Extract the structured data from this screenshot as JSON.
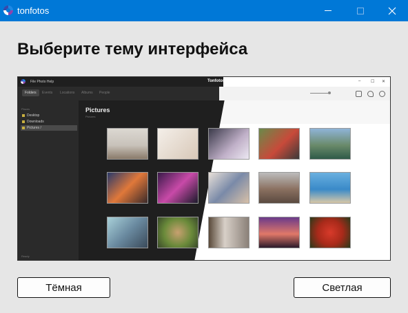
{
  "window": {
    "title": "tonfotos",
    "controls": {
      "minimize": "minimize-icon",
      "maximize": "maximize-icon",
      "close": "close-icon"
    }
  },
  "heading": "Выберите тему интерфейса",
  "preview": {
    "menu": "File  Photo  Help",
    "app_name": "Tonfotos",
    "tabs": [
      "Folders",
      "Events",
      "Locations",
      "Albums",
      "People"
    ],
    "sidebar_label": "Places",
    "folders": [
      "Desktop",
      "Downloads",
      "Pictures /"
    ],
    "content_title": "Pictures",
    "content_subtitle": "Pictures",
    "status": "Ready",
    "window_controls": [
      "–",
      "☐",
      "✕"
    ],
    "photos": [
      "woman-yoga-photo",
      "man-relaxing-photo",
      "laptop-desk-photo",
      "couple-photo",
      "mountain-lake-photo",
      "concert-lights-photo",
      "fireworks-photo",
      "camera-woman-photo",
      "old-town-photo",
      "beach-photo",
      "man-sunglasses-photo",
      "hands-circle-photo",
      "corridor-photo",
      "sunset-jump-photo",
      "apples-photo"
    ]
  },
  "buttons": {
    "dark": "Тёмная",
    "light": "Светлая"
  },
  "colors": {
    "titlebar": "#0078d7",
    "background": "#e6e6e6",
    "dark_theme": "#1f1f1f",
    "light_theme": "#ffffff"
  }
}
